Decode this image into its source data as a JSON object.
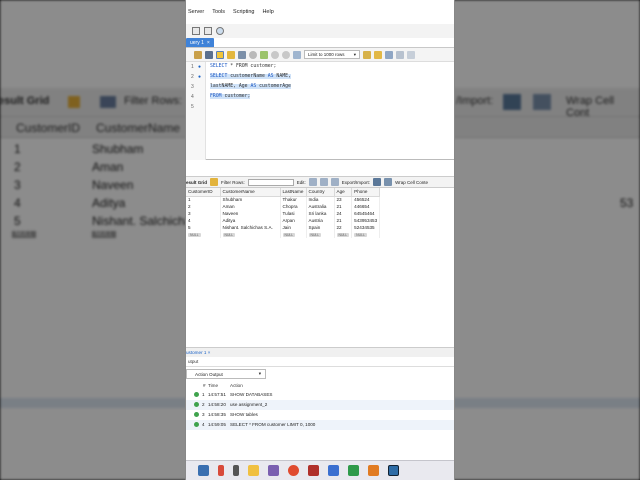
{
  "menu": [
    "Server",
    "Tools",
    "Scripting",
    "Help"
  ],
  "file_tab": {
    "label": "uery 1",
    "close": "×"
  },
  "toolbar": {
    "limit_label": "Limit to 1000 rows"
  },
  "editor": {
    "line_numbers": [
      "1",
      "2",
      "3",
      "4",
      "5"
    ],
    "line1_keyword": "SELECT",
    "line1_rest": " * FROM customer;",
    "line2_keyword": "SELECT",
    "line2_rest": " customerName ",
    "line2_as": "AS",
    "line2_tail": " NAME,",
    "line3_a": "lastNAME, Age ",
    "line3_as": "AS",
    "line3_b": " customerAge",
    "line4_keyword": "FROM",
    "line4_rest": " customer;"
  },
  "result_bar": {
    "grid_label": "esult Grid",
    "filter_label": "Filter Rows:",
    "edit_label": "Edit:",
    "export_label": "Export/Import:",
    "wrap_label": "Wrap Cell Conte"
  },
  "grid": {
    "columns": [
      "CustomerID",
      "CustomerName",
      "LastName",
      "Country",
      "Age",
      "Phone"
    ],
    "rows": [
      [
        "1",
        "Shubham",
        "Thakur",
        "India",
        "23",
        "456524"
      ],
      [
        "2",
        "Aman",
        "Chopra",
        "Australia",
        "21",
        "446654"
      ],
      [
        "3",
        "Naveen",
        "Tulasi",
        "Sri lanka",
        "24",
        "64545464"
      ],
      [
        "4",
        "Aditya",
        "Arpan",
        "Austria",
        "21",
        "543953453"
      ],
      [
        "5",
        "Nishant. Salchichas S.A.",
        "Jain",
        "Spain",
        "22",
        "52434535"
      ]
    ],
    "null_label": "NULL"
  },
  "result_tab": "ustomer 1  ×",
  "output": {
    "label": "utput",
    "selector": "Action Output",
    "headers": {
      "num": "#",
      "time": "Time",
      "action": "Action"
    },
    "rows": [
      {
        "num": "1",
        "time": "14:57:51",
        "action": "SHOW DATABASES"
      },
      {
        "num": "2",
        "time": "14:58:20",
        "action": "use assignment_2"
      },
      {
        "num": "3",
        "time": "14:58:35",
        "action": "SHOW tables"
      },
      {
        "num": "4",
        "time": "14:59:05",
        "action": "SELECT * FROM customer LIMIT 0, 1000"
      }
    ]
  },
  "background": {
    "grid_label": "esult Grid",
    "filter_label": "Filter Rows:",
    "export_label": "/Import:",
    "wrap_label": "Wrap Cell Cont",
    "col1": "CustomerID",
    "col2": "CustomerName",
    "ids": [
      "1",
      "2",
      "3",
      "4",
      "5"
    ],
    "names": [
      "Shubham",
      "Aman",
      "Naveen",
      "Aditya",
      "Nishant. Salchichas"
    ],
    "right_value": "53",
    "null_label": "NULL"
  },
  "colors": {
    "accent": "#3f82d8",
    "selection": "#cfe2f8",
    "ok": "#3fa34d"
  }
}
